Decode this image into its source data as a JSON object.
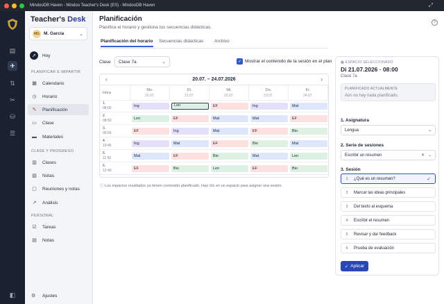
{
  "window": {
    "title": "MindooDB Haven - Mindoo Teacher's Desk (ES) - MindooDB Haven"
  },
  "colors": {
    "accent": "#3a5bd9",
    "Ing": "#e4e0fa",
    "Len": "#dcf1e3",
    "EF": "#fde0e0",
    "Mat": "#dde6fb",
    "Bio": "#dff1e2"
  },
  "brand": {
    "part1": "Teacher's",
    "part2": "Desk"
  },
  "user": {
    "initials": "MG",
    "name": "M. García"
  },
  "sidebar": {
    "hoy": "Hoy",
    "section_plan": "PLANIFICAR E IMPARTIR",
    "plan_items": [
      "Calendario",
      "Horario",
      "Planificación",
      "Clase",
      "Materiales"
    ],
    "section_clases": "CLASE Y PROGRESO",
    "clases_items": [
      "Clases",
      "Notas",
      "Reuniones y notas",
      "Análisis"
    ],
    "section_personal": "PERSONAL",
    "personal_items": [
      "Tareas",
      "Notas"
    ],
    "settings": "Ajustes"
  },
  "page": {
    "title": "Planificación",
    "subtitle": "Planifica el horario y gestiona tus secuencias didácticas."
  },
  "tabs": [
    "Planificación del horario",
    "Secuencias didácticas",
    "Archivo"
  ],
  "class_label": "Clase",
  "class_value": "Clase 7a",
  "show_content_label": "Mostrar el contenido de la sesión en el plan",
  "calendar": {
    "range": "20.07. – 24.07.2026",
    "hora": "Hora",
    "days": [
      {
        "name": "Mo.",
        "date": "20.07."
      },
      {
        "name": "Di.",
        "date": "21.07."
      },
      {
        "name": "Mi.",
        "date": "22.07."
      },
      {
        "name": "Do.",
        "date": "23.07."
      },
      {
        "name": "Fr.",
        "date": "24.07."
      }
    ],
    "periods": [
      {
        "n": "1.",
        "time": "08:00",
        "cells": [
          "Ing",
          "Len",
          "EF",
          "Ing",
          "Mat"
        ]
      },
      {
        "n": "2.",
        "time": "08:50",
        "cells": [
          "Len",
          "EF",
          "Mat",
          "Mat",
          "EF"
        ]
      },
      {
        "n": "3.",
        "time": "09:55",
        "cells": [
          "EF",
          "Ing",
          "Mat",
          "EF",
          "Bio"
        ]
      },
      {
        "n": "4.",
        "time": "10:45",
        "cells": [
          "Ing",
          "Mat",
          "EF",
          "Bio",
          "Mat"
        ]
      },
      {
        "n": "5.",
        "time": "11:50",
        "cells": [
          "Mat",
          "EF",
          "Bio",
          "Mat",
          "Len"
        ]
      },
      {
        "n": "6.",
        "time": "12:40",
        "cells": [
          "EF",
          "Bio",
          "Len",
          "EF",
          "Bio"
        ]
      }
    ]
  },
  "legend": "Los espacios resaltados ya tienen contenido planificado. Haz clic en un espacio para asignar una sesión.",
  "panel": {
    "tag": "ESPACIO SELECCIONADO",
    "date": "Di 21.07.2026 · 08:00",
    "class": "Clase 7a",
    "planned_heading": "PLANIFICADO ACTUALMENTE",
    "planned_value": "Aún no hay nada planificado.",
    "subject_label": "1. Asignatura",
    "subject_value": "Lengua",
    "series_label": "2. Serie de sesiones",
    "series_value": "Escribir un resumen",
    "session_label": "3. Sesión",
    "sessions": [
      {
        "n": "1",
        "label": "¿Qué es un resumen?",
        "selected": true
      },
      {
        "n": "2",
        "label": "Marcar las ideas principales",
        "selected": false
      },
      {
        "n": "3",
        "label": "Del texto al esquema",
        "selected": false
      },
      {
        "n": "4",
        "label": "Escribir el resumen",
        "selected": false
      },
      {
        "n": "5",
        "label": "Revisar y dar feedback",
        "selected": false
      },
      {
        "n": "6",
        "label": "Prueba de evaluación",
        "selected": false
      }
    ],
    "apply": "Aplicar"
  }
}
